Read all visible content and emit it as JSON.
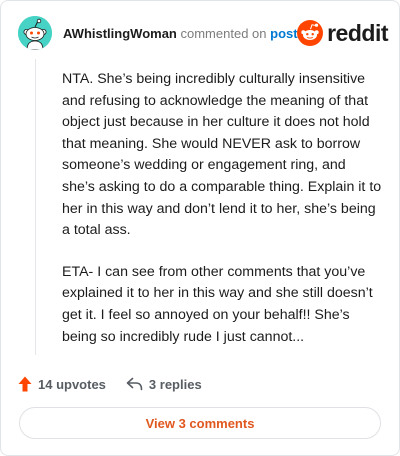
{
  "comment": {
    "author": "AWhistlingWoman",
    "action_text": "commented on",
    "target_link": "post",
    "paragraphs": [
      "NTA. She’s being incredibly culturally insensitive and refusing to acknowledge the meaning of that object just because in her culture it does not hold that meaning. She would NEVER ask to borrow someone’s wedding or engagement ring, and she’s asking to do a comparable thing. Explain it to her in this way and don’t lend it to her, she’s being a total ass.",
      "ETA- I can see from other comments that you’ve explained it to her in this way and she still doesn’t get it. I feel so annoyed on your behalf!! She’s being so incredibly rude I just cannot..."
    ]
  },
  "brand": {
    "name": "reddit",
    "icon": "reddit-snoo-icon",
    "color": "#ff4500"
  },
  "stats": {
    "upvotes_label": "14 upvotes",
    "replies_label": "3 replies",
    "upvote_icon": "upvote-arrow-icon",
    "reply_icon": "reply-arrow-icon",
    "upvote_color": "#ff4500"
  },
  "actions": {
    "view_comments_label": "View 3 comments"
  },
  "colors": {
    "link": "#0079d3",
    "accent": "#e0581f",
    "avatar_bg": "#46d3c6"
  }
}
